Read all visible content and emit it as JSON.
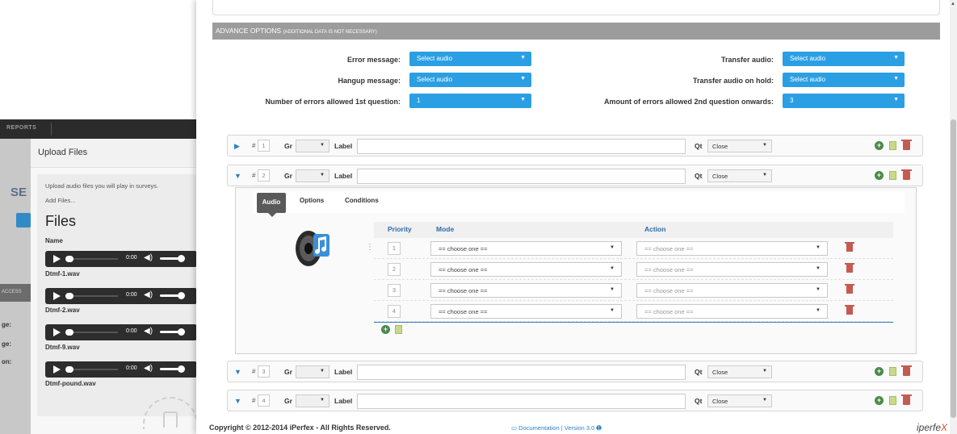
{
  "back_window": {
    "navbar": {
      "reports_label": "REPORTS"
    },
    "left_strip": {
      "se_label": "SE",
      "dark_text": "ACCESS",
      "labels": [
        "ge:",
        "ge:",
        "on:"
      ]
    },
    "upload": {
      "title": "Upload Files",
      "description": "Upload audio files you will play in surveys.",
      "add_files": "Add Files...",
      "files_heading": "Files",
      "name_column": "Name",
      "files": [
        {
          "name": "Dtmf-1.wav",
          "time": "0:00"
        },
        {
          "name": "Dtmf-2.wav",
          "time": "0:00"
        },
        {
          "name": "Dtmf-9.wav",
          "time": "0:00"
        },
        {
          "name": "Dtmf-pound.wav",
          "time": "0:00"
        }
      ]
    }
  },
  "advance": {
    "title": "ADVANCE OPTIONS",
    "subtitle": "(ADDITIONAL DATA IS NOT NECESSARY)",
    "left_options": [
      {
        "label": "Error message:",
        "value": "Select audio"
      },
      {
        "label": "Hangup message:",
        "value": "Select audio"
      },
      {
        "label": "Number of errors allowed 1st question:",
        "value": "1"
      }
    ],
    "right_options": [
      {
        "label": "Transfer audio:",
        "value": "Select audio"
      },
      {
        "label": "Transfer audio on hold:",
        "value": "Select audio"
      },
      {
        "label": "Amount of errors allowed 2nd question onwards:",
        "value": "3"
      }
    ]
  },
  "questions": [
    {
      "num": "1",
      "gr_label": "Gr",
      "label_label": "Label",
      "label_value": "",
      "qt_label": "Qt",
      "qt_value": "Close"
    },
    {
      "num": "2",
      "gr_label": "Gr",
      "label_label": "Label",
      "label_value": "",
      "qt_label": "Qt",
      "qt_value": "Close"
    },
    {
      "num": "3",
      "gr_label": "Gr",
      "label_label": "Label",
      "label_value": "",
      "qt_label": "Qt",
      "qt_value": "Close"
    },
    {
      "num": "4",
      "gr_label": "Gr",
      "label_label": "Label",
      "label_value": "",
      "qt_label": "Qt",
      "qt_value": "Close"
    }
  ],
  "hash_label": "#",
  "expanded": {
    "tabs": {
      "audio": "Audio",
      "options": "Options",
      "conditions": "Conditions"
    },
    "columns": {
      "priority": "Priority",
      "mode": "Mode",
      "action": "Action"
    },
    "rows": [
      {
        "priority": "1",
        "mode": "== choose one ==",
        "action": "== choose one =="
      },
      {
        "priority": "2",
        "mode": "== choose one ==",
        "action": "== choose one =="
      },
      {
        "priority": "3",
        "mode": "== choose one ==",
        "action": "== choose one =="
      },
      {
        "priority": "4",
        "mode": "== choose one ==",
        "action": "== choose one =="
      }
    ]
  },
  "footer": {
    "copyright": "Copyright © 2012-2014 iPerfex - All Rights Reserved.",
    "docs": "Documentation | Version 3.0",
    "brand": "iperfe",
    "brand_x": "X"
  },
  "colors": {
    "accent_blue": "#2b9fe3",
    "bar_gray": "#9c9c9c",
    "link_blue": "#2b7fc4",
    "delete_red": "#c45a50"
  }
}
